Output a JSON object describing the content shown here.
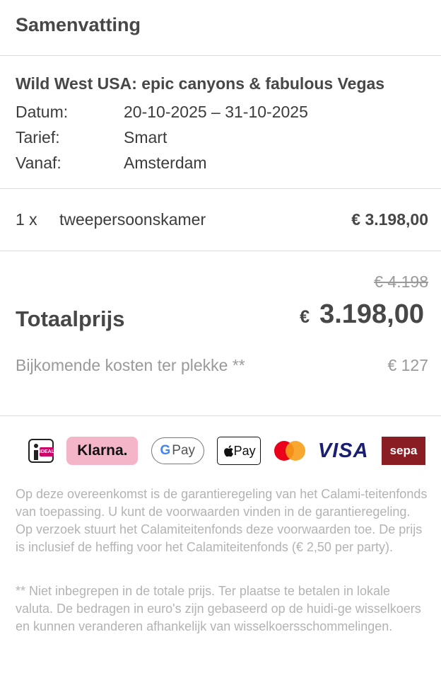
{
  "header": {
    "title": "Samenvatting"
  },
  "trip": {
    "title": "Wild West USA: epic canyons & fabulous Vegas",
    "details": [
      {
        "label": "Datum:",
        "value": "20-10-2025 – 31-10-2025"
      },
      {
        "label": "Tarief:",
        "value": "Smart"
      },
      {
        "label": "Vanaf:",
        "value": "Amsterdam"
      }
    ]
  },
  "lines": [
    {
      "qty": "1 x",
      "description": "tweepersoonskamer",
      "price": "€ 3.198,00"
    }
  ],
  "totals": {
    "old_price": "€ 4.198",
    "label": "Totaalprijs",
    "currency": "€",
    "amount": "3.198,00",
    "extra_label": "Bijkomende kosten ter plekke **",
    "extra_value": "€ 127"
  },
  "payments": {
    "ideal": "iDEAL",
    "klarna": "Klarna.",
    "google_pay_g": "G",
    "google_pay": "Pay",
    "apple_pay": " Pay",
    "visa": "VISA",
    "sepa": "sepa"
  },
  "legal": {
    "paragraph1": "Op deze overeenkomst is de garantieregeling van het Calami-teitenfonds van toepassing. U kunt de voorwaarden vinden in de garantieregeling. Op verzoek stuurt het Calamiteitenfonds deze voorwaarden toe. De prijs is inclusief de heffing voor het Calamiteitenfonds (€ 2,50 per party).",
    "paragraph2": "** Niet inbegrepen in de totale prijs. Ter plaatse te betalen in lokale valuta. De bedragen in euro's zijn gebaseerd op de huidi-ge wisselkoers en kunnen veranderen afhankelijk van wisselkoersschommelingen."
  }
}
